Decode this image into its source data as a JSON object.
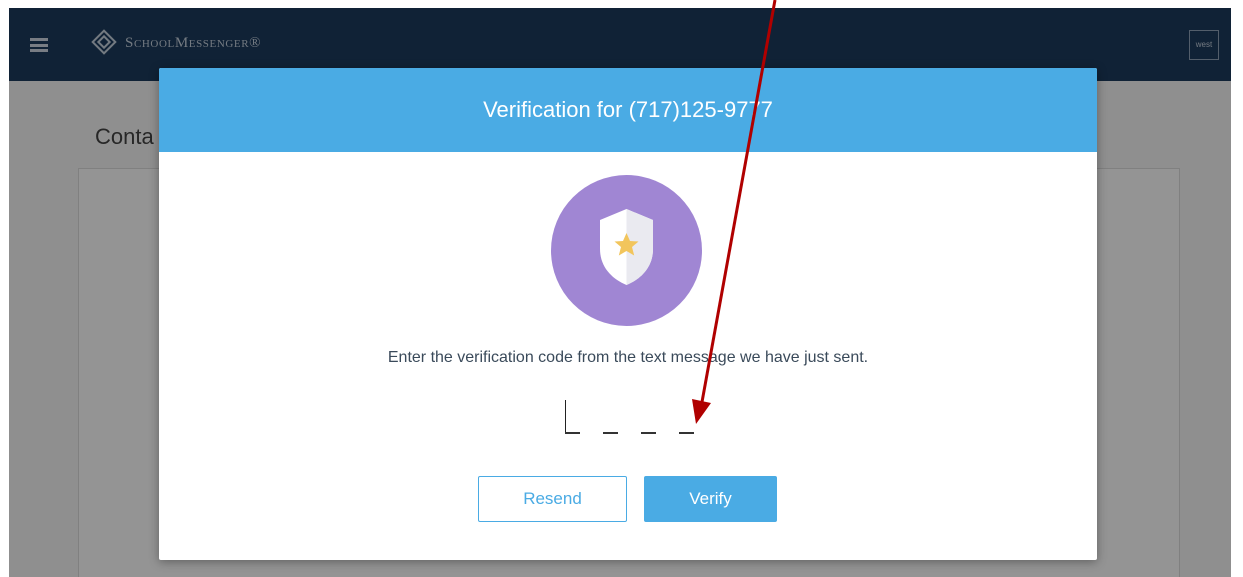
{
  "app": {
    "logo_text": "SchoolMessenger®",
    "user_box_text": "west"
  },
  "page": {
    "title_fragment": "Conta"
  },
  "modal": {
    "title": "Verification for (717)125-9777",
    "instructions": "Enter the verification code from the text message we have just sent.",
    "code_slots": 4,
    "resend_label": "Resend",
    "verify_label": "Verify"
  },
  "icons": {
    "menu": "hamburger-icon",
    "logo": "schoolmessenger-logo-icon",
    "badge": "shield-star-icon"
  },
  "colors": {
    "topbar": "#1c3b5e",
    "modal_header": "#4aabe4",
    "badge": "#a086d3",
    "annotation_arrow": "#b00000"
  }
}
